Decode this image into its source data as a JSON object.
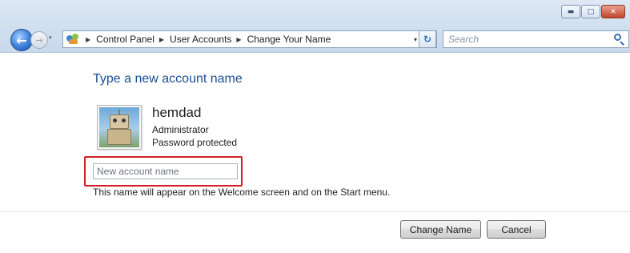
{
  "window": {
    "controls": {
      "minimize_glyph": "▬",
      "maximize_glyph": "□",
      "close_glyph": "✕"
    }
  },
  "navigation": {
    "back_glyph": "←",
    "forward_glyph": "→",
    "recent_glyph": "▾"
  },
  "address_bar": {
    "icon": "control-panel-icon",
    "breadcrumbs": [
      "Control Panel",
      "User Accounts",
      "Change Your Name"
    ],
    "separator_glyph": "▶",
    "dropdown_glyph": "▾",
    "refresh_glyph": "↻"
  },
  "search": {
    "placeholder": "Search",
    "icon": "search-icon"
  },
  "main": {
    "title": "Type a new account name",
    "user": {
      "name": "hemdad",
      "role": "Administrator",
      "status": "Password protected",
      "avatar_icon": "robot-avatar"
    },
    "name_input": {
      "value": "",
      "placeholder": "New account name"
    },
    "hint": "This name will appear on the Welcome screen and on the Start menu.",
    "highlight_color": "#d01f25"
  },
  "actions": {
    "change_label": "Change Name",
    "cancel_label": "Cancel"
  },
  "colors": {
    "title_blue": "#1a4e96",
    "chrome": "#d3e1f1"
  }
}
